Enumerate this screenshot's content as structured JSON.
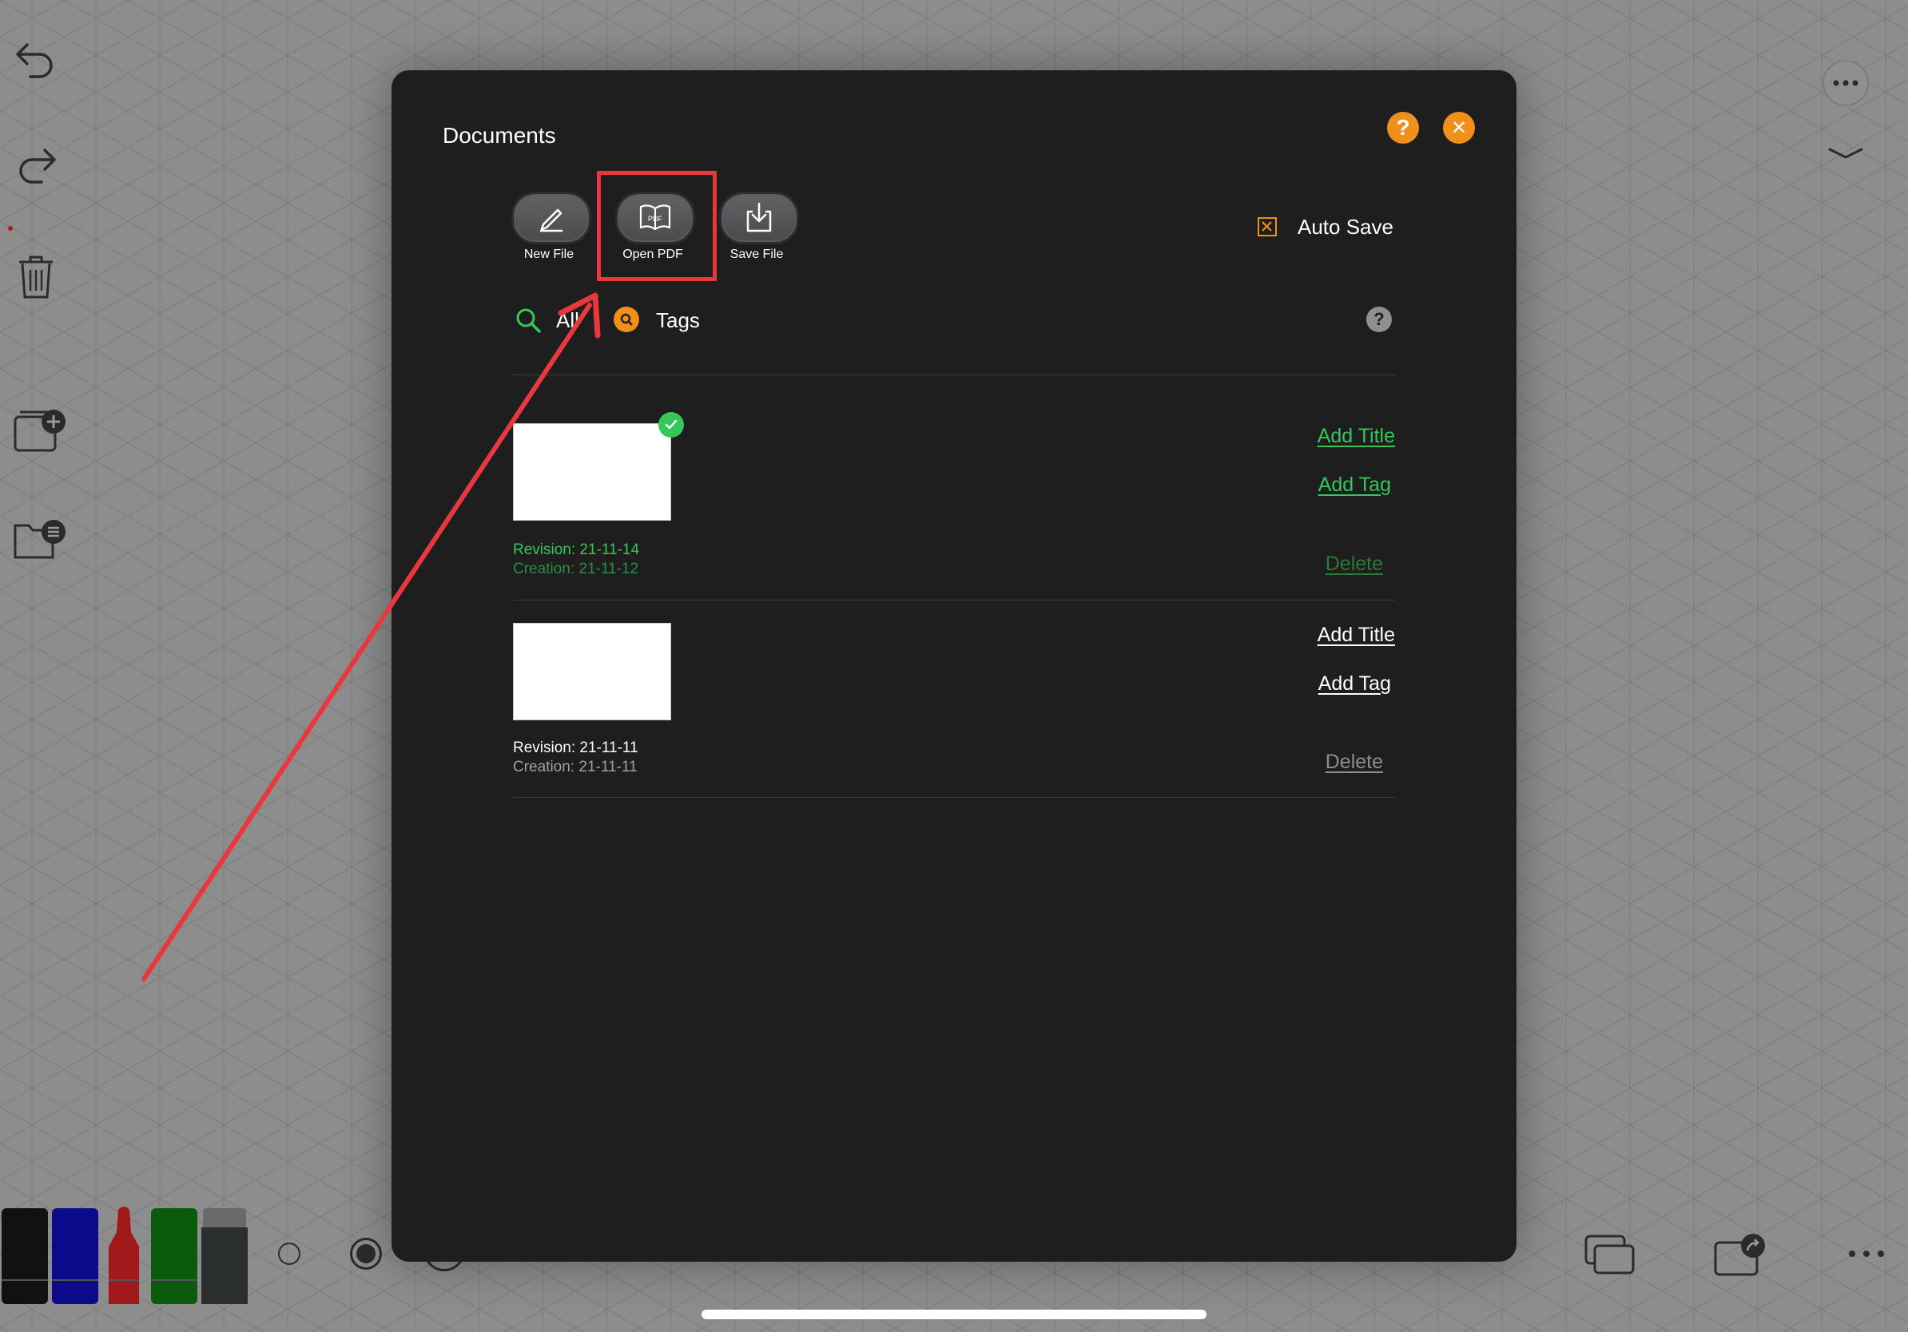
{
  "modal": {
    "title": "Documents",
    "help_glyph": "?",
    "close_glyph": "✕",
    "toolbar": {
      "new_file": "New File",
      "open_pdf": "Open PDF",
      "save_file": "Save File",
      "pdf_glyph": "PDF"
    },
    "auto_save": {
      "label": "Auto Save",
      "checked": true
    },
    "filter": {
      "all_label": "All",
      "tags_label": "Tags",
      "help_glyph": "?"
    },
    "documents": [
      {
        "revision": "Revision: 21-11-14",
        "creation": "Creation: 21-11-12",
        "add_title": "Add Title",
        "add_tag": "Add Tag",
        "delete": "Delete",
        "current": true
      },
      {
        "revision": "Revision: 21-11-11",
        "creation": "Creation: 21-11-11",
        "add_title": "Add Title",
        "add_tag": "Add Tag",
        "delete": "Delete",
        "current": false
      }
    ]
  },
  "colors": {
    "accent_orange": "#f0901a",
    "current_green": "#34c759",
    "highlight_red": "#e8383d",
    "modal_bg": "#1e1e1f"
  },
  "icons": {
    "left_toolbar": [
      "undo-icon",
      "redo-icon",
      "trash-icon",
      "new-page-icon",
      "folder-list-icon"
    ],
    "right_toolbar": [
      "more-icon",
      "collapse-chevron-icon"
    ],
    "bottom_right": [
      "pages-icon",
      "share-icon",
      "more-icon"
    ]
  },
  "markers": [
    "black",
    "blue",
    "red",
    "green",
    "eraser"
  ],
  "brush_sizes": [
    "small",
    "medium",
    "large"
  ]
}
